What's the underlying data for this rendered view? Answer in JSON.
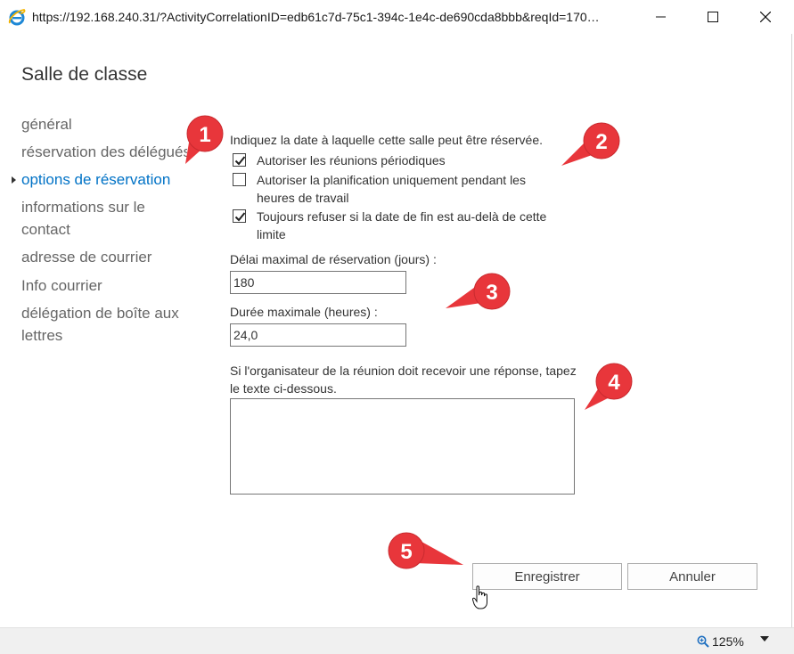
{
  "window": {
    "url": "https://192.168.240.31/?ActivityCorrelationID=edb61c7d-75c1-394c-1e4c-de690cda8bbb&reqId=170…",
    "icon": "internet-explorer-icon"
  },
  "page": {
    "title": "Salle de classe"
  },
  "nav": {
    "items": [
      {
        "label": "général"
      },
      {
        "label": "réservation des délégués"
      },
      {
        "label": "options de réservation",
        "active": true
      },
      {
        "label": "informations sur le contact"
      },
      {
        "label": "adresse de courrier"
      },
      {
        "label": "Info courrier"
      },
      {
        "label": "délégation de boîte aux lettres"
      }
    ]
  },
  "form": {
    "intro": "Indiquez la date à laquelle cette salle peut être réservée.",
    "checkboxes": [
      {
        "label": "Autoriser les réunions périodiques",
        "checked": true
      },
      {
        "label": "Autoriser la planification uniquement pendant les heures de travail",
        "checked": false
      },
      {
        "label": "Toujours refuser si la date de fin est au-delà de cette limite",
        "checked": true
      }
    ],
    "max_booking_label": "Délai maximal de réservation (jours) :",
    "max_booking_value": "180",
    "max_duration_label": "Durée maximale (heures) :",
    "max_duration_value": "24,0",
    "response_label": "Si l'organisateur de la réunion doit recevoir une réponse, tapez le texte ci-dessous.",
    "response_value": ""
  },
  "buttons": {
    "save": "Enregistrer",
    "cancel": "Annuler"
  },
  "status": {
    "zoom": "125%"
  },
  "annotations": {
    "callout_1": "1",
    "callout_2": "2",
    "callout_3": "3",
    "callout_4": "4",
    "callout_5": "5",
    "color": "#e8363b"
  }
}
